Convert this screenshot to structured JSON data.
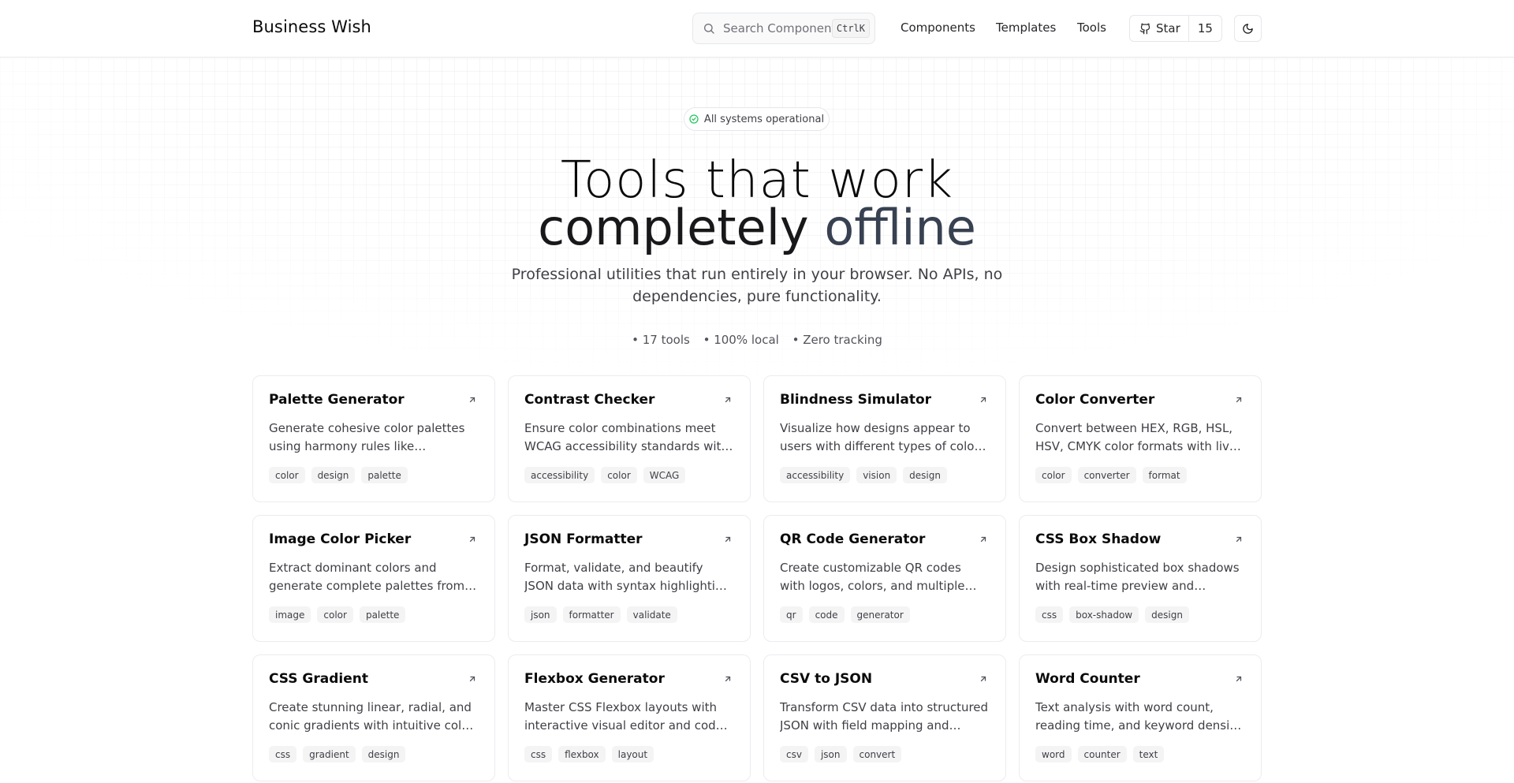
{
  "header": {
    "brand": "Business Wish",
    "search_placeholder": "Search Components",
    "shortcut": "CtrlK",
    "nav": [
      "Components",
      "Templates",
      "Tools"
    ],
    "star_label": "Star",
    "star_count": "15"
  },
  "hero": {
    "status": "All systems operational",
    "line1": "Tools that work",
    "line2_strong": "completely",
    "line2_soft": "offline",
    "subtitle": "Professional utilities that run entirely in your browser. No APIs, no dependencies, pure functionality.",
    "stats": [
      "• 17 tools",
      "• 100% local",
      "• Zero tracking"
    ]
  },
  "cards": [
    {
      "title": "Palette Generator",
      "desc": "Generate cohesive color palettes using harmony rules like complementary and triadic",
      "tags": [
        "color",
        "design",
        "palette"
      ]
    },
    {
      "title": "Contrast Checker",
      "desc": "Ensure color combinations meet WCAG accessibility standards with detailed ratios",
      "tags": [
        "accessibility",
        "color",
        "WCAG"
      ]
    },
    {
      "title": "Blindness Simulator",
      "desc": "Visualize how designs appear to users with different types of color blindness",
      "tags": [
        "accessibility",
        "vision",
        "design"
      ]
    },
    {
      "title": "Color Converter",
      "desc": "Convert between HEX, RGB, HSL, HSV, CMYK color formats with live preview",
      "tags": [
        "color",
        "converter",
        "format"
      ]
    },
    {
      "title": "Image Color Picker",
      "desc": "Extract dominant colors and generate complete palettes from any uploaded image",
      "tags": [
        "image",
        "color",
        "palette"
      ]
    },
    {
      "title": "JSON Formatter",
      "desc": "Format, validate, and beautify JSON data with syntax highlighting and error detection",
      "tags": [
        "json",
        "formatter",
        "validate"
      ]
    },
    {
      "title": "QR Code Generator",
      "desc": "Create customizable QR codes with logos, colors, and multiple export formats",
      "tags": [
        "qr",
        "code",
        "generator"
      ]
    },
    {
      "title": "CSS Box Shadow",
      "desc": "Design sophisticated box shadows with real-time preview and optimized CSS output",
      "tags": [
        "css",
        "box-shadow",
        "design"
      ]
    },
    {
      "title": "CSS Gradient",
      "desc": "Create stunning linear, radial, and conic gradients with intuitive color stops",
      "tags": [
        "css",
        "gradient",
        "design"
      ]
    },
    {
      "title": "Flexbox Generator",
      "desc": "Master CSS Flexbox layouts with interactive visual editor and code export",
      "tags": [
        "css",
        "flexbox",
        "layout"
      ]
    },
    {
      "title": "CSV to JSON",
      "desc": "Transform CSV data into structured JSON with field mapping and validation",
      "tags": [
        "csv",
        "json",
        "convert"
      ]
    },
    {
      "title": "Word Counter",
      "desc": "Text analysis with word count, reading time, and keyword density statistics",
      "tags": [
        "word",
        "counter",
        "text"
      ]
    }
  ]
}
